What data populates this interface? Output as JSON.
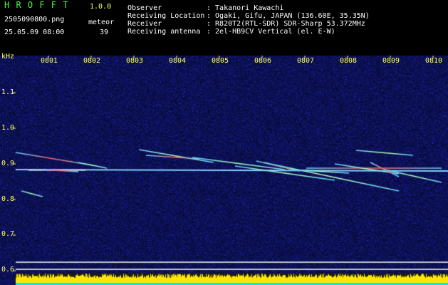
{
  "app": {
    "name": "H R O F F T",
    "version": "1.0.0"
  },
  "file": {
    "name": "2505090800.png",
    "datetime": "25.05.09 08:00"
  },
  "meteor": {
    "label": "meteor",
    "count": "39"
  },
  "info": [
    {
      "key": "Observer",
      "value": ": Takanori Kawachi"
    },
    {
      "key": "Receiving Location",
      "value": ": Ogaki, Gifu, JAPAN (136.60E, 35.35N)"
    },
    {
      "key": "Receiver",
      "value": ": R820T2(RTL-SDR) SDR-Sharp 53.372MHz"
    },
    {
      "key": "Receiving antenna",
      "value": ": 2el-HB9CV Vertical (el. E-W)"
    }
  ],
  "axes": {
    "y_unit": "kHz",
    "y_ticks": [
      "1.1",
      "1.0",
      "0.9",
      "0.8",
      "0.7",
      "0.6"
    ],
    "x_ticks": [
      "0801",
      "0802",
      "0803",
      "0804",
      "0805",
      "0806",
      "0807",
      "0808",
      "0809",
      "0810"
    ]
  },
  "colors": {
    "background": "#000000",
    "spectro_bg": "#0a0a6a",
    "header_title": "#3cff3c",
    "labels": "#ffff5a",
    "text": "#ffffff",
    "carrier": "#7fd0ff",
    "level_bar": "#ffe600"
  }
}
